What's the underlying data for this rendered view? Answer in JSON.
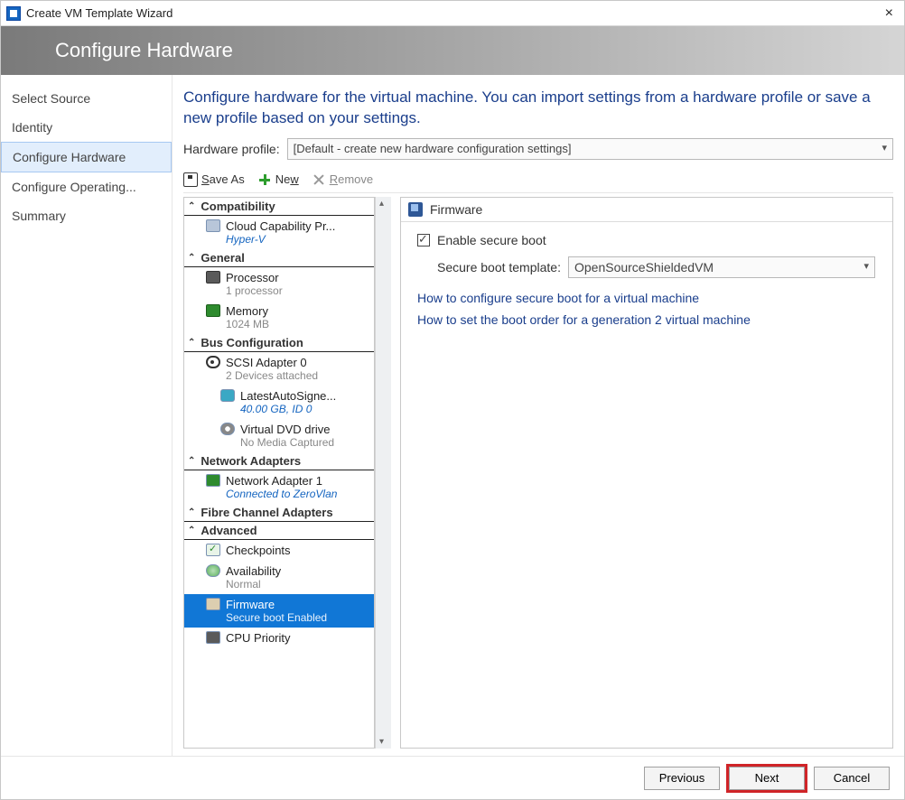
{
  "window": {
    "title": "Create VM Template Wizard"
  },
  "banner": {
    "title": "Configure Hardware"
  },
  "wizard_nav": {
    "items": [
      {
        "label": "Select Source"
      },
      {
        "label": "Identity"
      },
      {
        "label": "Configure Hardware"
      },
      {
        "label": "Configure Operating..."
      },
      {
        "label": "Summary"
      }
    ]
  },
  "main": {
    "instruction": "Configure hardware for the virtual machine. You can import settings from a hardware profile or save a new profile based on your settings.",
    "profile_label": "Hardware profile:",
    "profile_value": "[Default - create new hardware configuration settings]",
    "toolbar": {
      "save_as": "Save As",
      "new": "New",
      "remove": "Remove"
    }
  },
  "tree": {
    "sections": {
      "compat": "Compatibility",
      "general": "General",
      "bus": "Bus Configuration",
      "net": "Network Adapters",
      "fc": "Fibre Channel Adapters",
      "adv": "Advanced"
    },
    "cloud": {
      "title": "Cloud Capability Pr...",
      "sub": "Hyper-V"
    },
    "processor": {
      "title": "Processor",
      "sub": "1 processor"
    },
    "memory": {
      "title": "Memory",
      "sub": "1024 MB"
    },
    "scsi": {
      "title": "SCSI Adapter 0",
      "sub": "2 Devices attached"
    },
    "disk": {
      "title": "LatestAutoSigne...",
      "sub": "40.00 GB, ID 0"
    },
    "dvd": {
      "title": "Virtual DVD drive",
      "sub": "No Media Captured"
    },
    "na1": {
      "title": "Network Adapter 1",
      "sub": "Connected to ZeroVlan"
    },
    "checkpoints": {
      "title": "Checkpoints",
      "sub": ""
    },
    "availability": {
      "title": "Availability",
      "sub": "Normal"
    },
    "firmware": {
      "title": "Firmware",
      "sub": "Secure boot Enabled"
    },
    "cpu_priority": {
      "title": "CPU Priority",
      "sub": ""
    }
  },
  "detail": {
    "header": "Firmware",
    "enable_secure_boot": "Enable secure boot",
    "template_label": "Secure boot template:",
    "template_value": "OpenSourceShieldedVM",
    "link1": "How to configure secure boot for a virtual machine",
    "link2": "How to set the boot order for a generation 2 virtual machine"
  },
  "buttons": {
    "previous": "Previous",
    "next": "Next",
    "cancel": "Cancel"
  }
}
